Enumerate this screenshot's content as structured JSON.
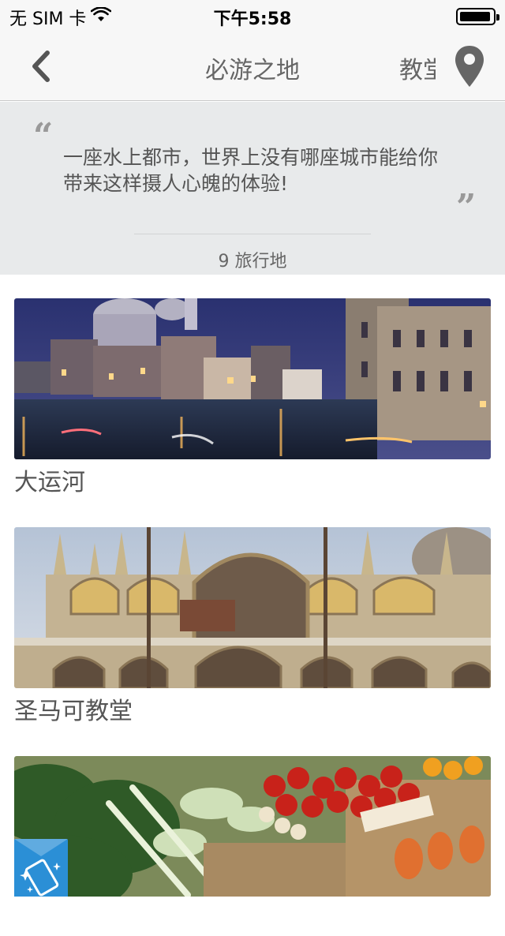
{
  "status_bar": {
    "carrier": "无 SIM 卡",
    "time": "下午5:58"
  },
  "nav": {
    "title": "必游之地",
    "tag": "教堂",
    "back_icon": "chevron-left-icon",
    "pin_icon": "map-pin-icon"
  },
  "intro": {
    "quote": "一座水上都市，世界上没有哪座城市能给你带来这样摄人心魄的体验!",
    "open_mark": "“",
    "close_mark": "”",
    "count": "9 旅行地"
  },
  "places": [
    {
      "name": "大运河"
    },
    {
      "name": "圣马可教堂"
    },
    {
      "name": ""
    }
  ],
  "colors": {
    "nav_bg": "#f7f7f7",
    "quote_bg": "#e8eaeb",
    "accent": "#2b8fd6"
  }
}
